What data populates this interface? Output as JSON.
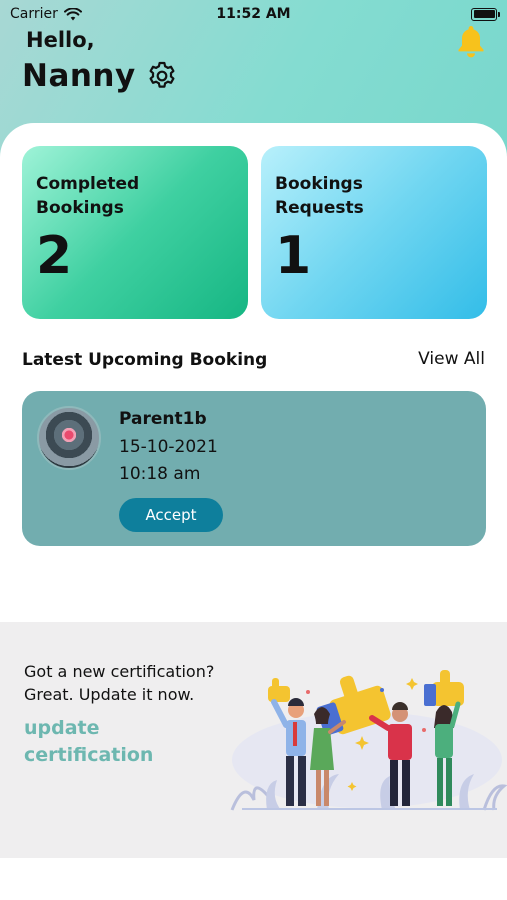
{
  "status_bar": {
    "carrier": "Carrier",
    "time": "11:52 AM"
  },
  "header": {
    "greeting": "Hello,",
    "name": "Nanny"
  },
  "stats": {
    "completed": {
      "label": "Completed Bookings",
      "count": "2"
    },
    "requests": {
      "label": "Bookings Requests",
      "count": "1"
    }
  },
  "upcoming": {
    "title": "Latest Upcoming Booking",
    "view_all": "View All",
    "booking": {
      "parent": "Parent1b",
      "date": "15-10-2021",
      "time": "10:18 am",
      "accept_label": "Accept"
    }
  },
  "promo": {
    "line1": "Got a new certification?",
    "line2": "Great. Update it now.",
    "link": "update certification"
  },
  "colors": {
    "header_teal": "#84dcd1",
    "completed_green": "#16b683",
    "requests_blue": "#33bde8",
    "booking_card": "#72adaf",
    "accept_button": "#0e7f9c",
    "link_teal": "#6db7b0",
    "bell_yellow": "#f7c21c"
  },
  "icons": [
    "wifi-icon",
    "battery-icon",
    "gear-icon",
    "bell-icon"
  ]
}
